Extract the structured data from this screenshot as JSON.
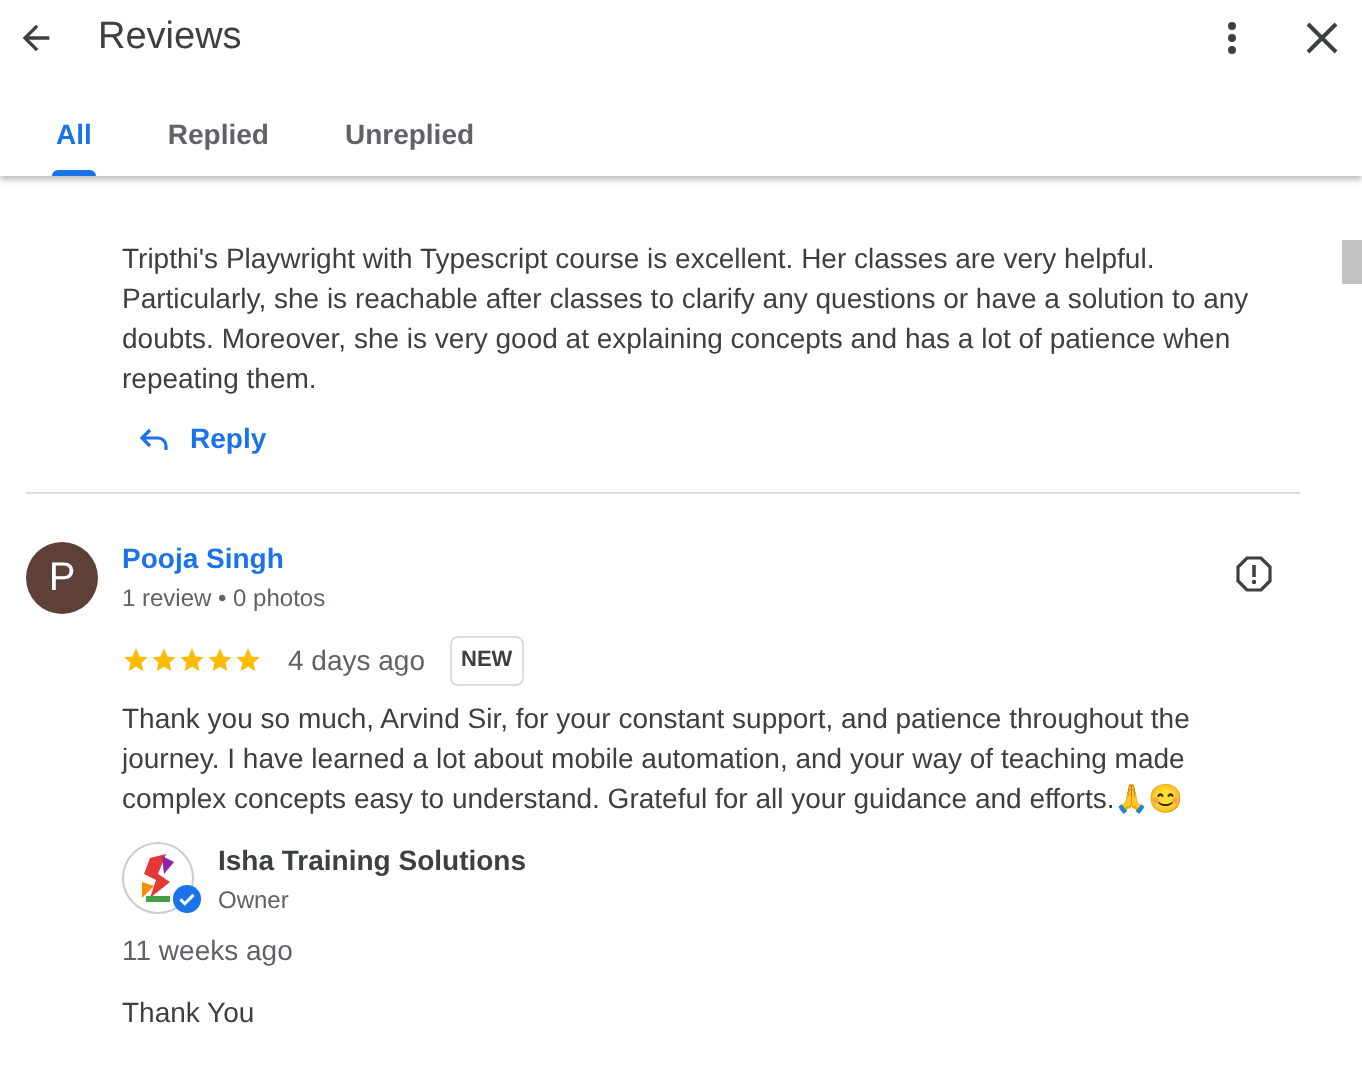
{
  "header": {
    "title": "Reviews"
  },
  "tabs": [
    {
      "label": "All",
      "selected": true
    },
    {
      "label": "Replied",
      "selected": false
    },
    {
      "label": "Unreplied",
      "selected": false
    }
  ],
  "reviews": [
    {
      "text": "Tripthi's Playwright with Typescript course is excellent. Her classes are very helpful. Particularly, she is reachable after classes to clarify any questions or have a solution to any doubts. Moreover, she is very good at explaining concepts and has a lot of patience when repeating them.",
      "reply_button": "Reply"
    },
    {
      "avatar_letter": "P",
      "author": "Pooja Singh",
      "meta": "1 review • 0 photos",
      "stars": 5,
      "time": "4 days ago",
      "badge": "NEW",
      "text": "Thank you so much, Arvind Sir, for your constant support, and patience throughout the journey. I have learned a lot about mobile automation, and your way of teaching made complex concepts easy to understand. Grateful for all your guidance and efforts.🙏😊",
      "owner_reply": {
        "name": "Isha Training Solutions",
        "role": "Owner",
        "verified": true,
        "time": "11 weeks ago",
        "text": "Thank You"
      }
    }
  ]
}
